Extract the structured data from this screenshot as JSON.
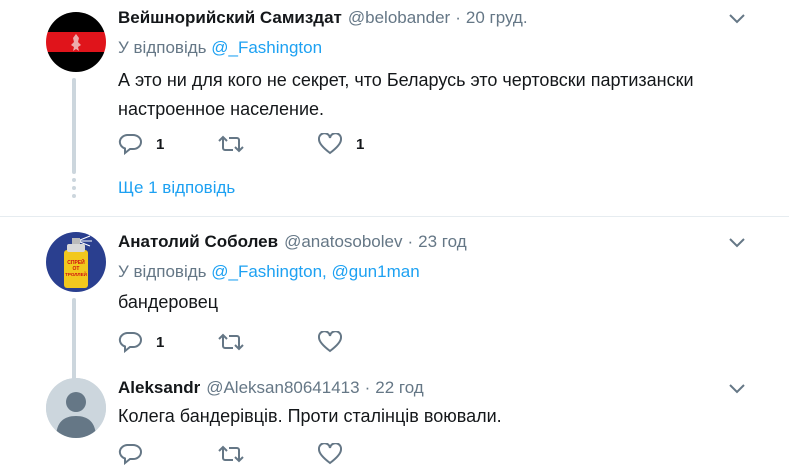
{
  "tweets": [
    {
      "name": "Вейшнорийский Самиздат",
      "handle": "@belobander",
      "separator": "·",
      "time": "20 груд.",
      "reply_prefix": "У відповідь",
      "reply_to": [
        "@_Fashington"
      ],
      "text": "А это ни для кого не секрет, что Беларусь это чертовски партизански настроенное население.",
      "reply_count": "1",
      "retweet_count": "",
      "like_count": "1",
      "show_replies": "Ще 1 відповідь",
      "avatar_colors": {
        "top": "#000000",
        "middle": "#e0141b",
        "bottom": "#000000"
      }
    },
    {
      "name": "Анатолий Соболев",
      "handle": "@anatosobolev",
      "separator": "·",
      "time": "23 год",
      "reply_prefix": "У відповідь",
      "reply_to": [
        "@_Fashington,",
        "@gun1man"
      ],
      "text": "бандеровец",
      "reply_count": "1",
      "retweet_count": "",
      "like_count": "",
      "avatar_text": "СПРЕЙ ОТ ТРОЛЛЕЙ",
      "avatar_colors": {
        "bg": "#2a3f8f",
        "can": "#f2c81e"
      }
    },
    {
      "name": "Aleksandr",
      "handle": "@Aleksan80641413",
      "separator": "·",
      "time": "22 год",
      "text": "Колега бандерівців. Проти сталінців воювали.",
      "avatar_colors": {
        "bg": "#ccd6dd",
        "fg": "#ffffff"
      }
    }
  ],
  "colors": {
    "link": "#1da1f2",
    "secondary": "#657786",
    "thread_line": "#ccd6dd",
    "divider": "#e6ecf0"
  }
}
